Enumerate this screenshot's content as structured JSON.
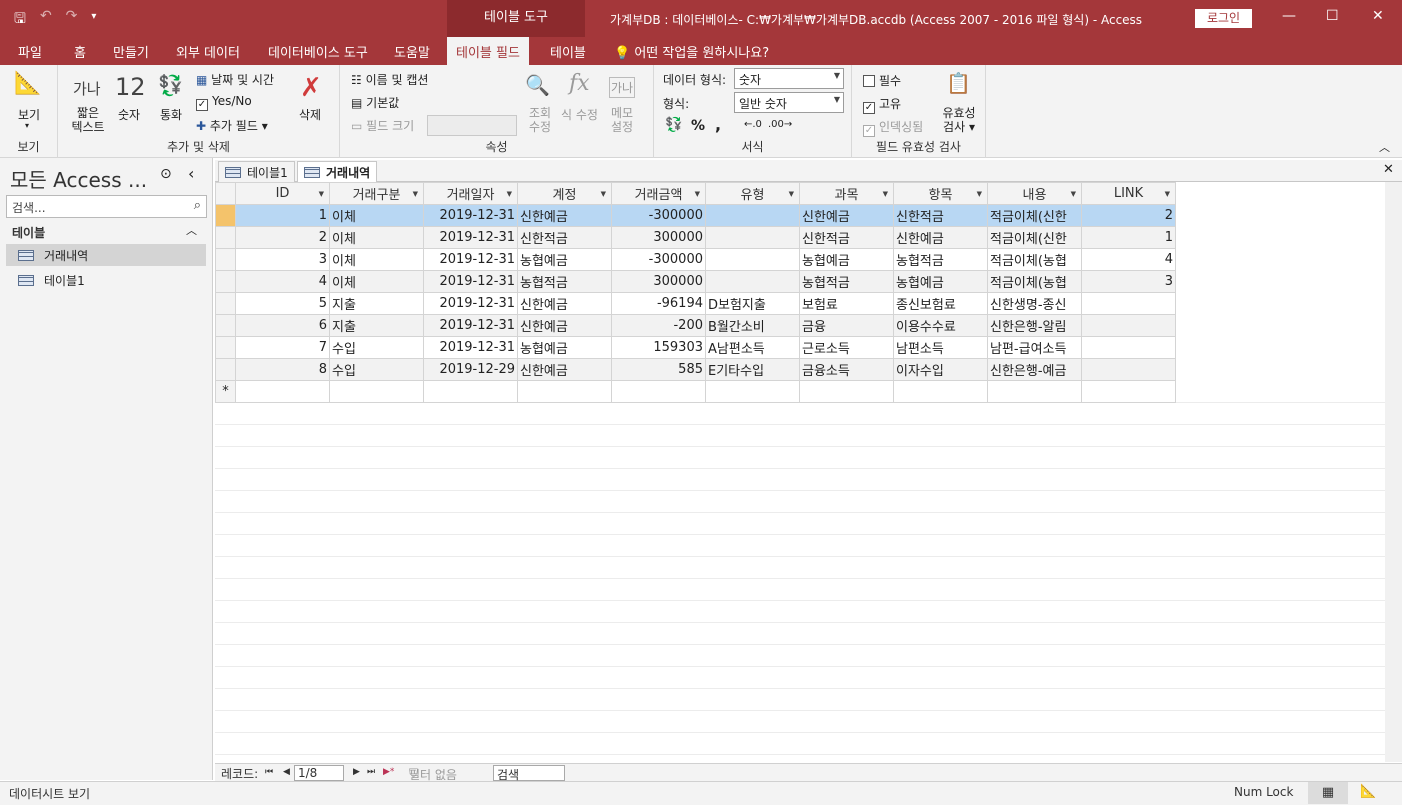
{
  "app": {
    "context_tool": "테이블 도구",
    "window_title": "가계부DB : 데이터베이스- C:₩가계부₩가계부DB.accdb (Access 2007 - 2016 파일 형식)  -  Access",
    "login": "로그인",
    "min_glyph": "—",
    "max_glyph": "☐",
    "close_glyph": "✕"
  },
  "qat": {
    "save": "🖫",
    "undo": "↶",
    "redo": "↷",
    "more": "▾"
  },
  "tabs": [
    "파일",
    "홈",
    "만들기",
    "외부 데이터",
    "데이터베이스 도구",
    "도움말",
    "테이블 필드",
    "테이블"
  ],
  "tell_me": "어떤 작업을 원하시나요?",
  "ribbon": {
    "view": {
      "label": "보기",
      "group": "보기"
    },
    "add_delete": {
      "short_text_icon": "가나",
      "short_text": "짧은 텍스트",
      "number_icon": "12",
      "number": "숫자",
      "currency": "통화",
      "date_time": "날짜 및 시간",
      "yes_no": "Yes/No",
      "more_fields": "추가 필드",
      "delete": "삭제",
      "group": "추가 및 삭제"
    },
    "properties": {
      "name_caption": "이름 및 캡션",
      "default_value": "기본값",
      "field_size": "필드 크기",
      "lookup_edit": "조회 수정",
      "expression_edit": "식 수정",
      "memo_settings": "메모 설정",
      "memo_icon": "가나",
      "group": "속성"
    },
    "formatting": {
      "data_type_label": "데이터 형식:",
      "data_type_value": "숫자",
      "format_label": "형식:",
      "format_value": "일반 숫자",
      "percent": "%",
      "comma": ",",
      "group": "서식"
    },
    "validation": {
      "required": "필수",
      "unique": "고유",
      "indexed": "인덱싱됨",
      "validation": "유효성 검사",
      "group": "필드 유효성 검사"
    }
  },
  "nav": {
    "title": "모든 Access ...",
    "search_placeholder": "검색...",
    "section": "테이블",
    "items": [
      "거래내역",
      "테이블1"
    ]
  },
  "doc_tabs": [
    "테이블1",
    "거래내역"
  ],
  "grid": {
    "columns": [
      "ID",
      "거래구분",
      "거래일자",
      "계정",
      "거래금액",
      "유형",
      "과목",
      "항목",
      "내용",
      "LINK"
    ],
    "rows": [
      [
        "1",
        "이체",
        "2019-12-31",
        "신한예금",
        "-300000",
        "",
        "신한예금",
        "신한적금",
        "적금이체(신한",
        "2"
      ],
      [
        "2",
        "이체",
        "2019-12-31",
        "신한적금",
        "300000",
        "",
        "신한적금",
        "신한예금",
        "적금이체(신한",
        "1"
      ],
      [
        "3",
        "이체",
        "2019-12-31",
        "농협예금",
        "-300000",
        "",
        "농협예금",
        "농협적금",
        "적금이체(농협",
        "4"
      ],
      [
        "4",
        "이체",
        "2019-12-31",
        "농협적금",
        "300000",
        "",
        "농협적금",
        "농협예금",
        "적금이체(농협",
        "3"
      ],
      [
        "5",
        "지출",
        "2019-12-31",
        "신한예금",
        "-96194",
        "D보험지출",
        "보험료",
        "종신보험료",
        "신한생명-종신",
        ""
      ],
      [
        "6",
        "지출",
        "2019-12-31",
        "신한예금",
        "-200",
        "B월간소비",
        "금융",
        "이용수수료",
        "신한은행-알림",
        ""
      ],
      [
        "7",
        "수입",
        "2019-12-31",
        "농협예금",
        "159303",
        "A남편소득",
        "근로소득",
        "남편소득",
        "남편-급여소득",
        ""
      ],
      [
        "8",
        "수입",
        "2019-12-29",
        "신한예금",
        "585",
        "E기타수입",
        "금융소득",
        "이자수입",
        "신한은행-예금",
        ""
      ]
    ],
    "new_row_marker": "*"
  },
  "record_nav": {
    "label": "레코드:",
    "first": "⏮",
    "prev": "◀",
    "position": "1/8",
    "next": "▶",
    "last": "⏭",
    "new": "▶*",
    "filter": "필터 없음",
    "search": "검색"
  },
  "status": {
    "left": "데이터시트 보기",
    "num_lock": "Num Lock"
  }
}
